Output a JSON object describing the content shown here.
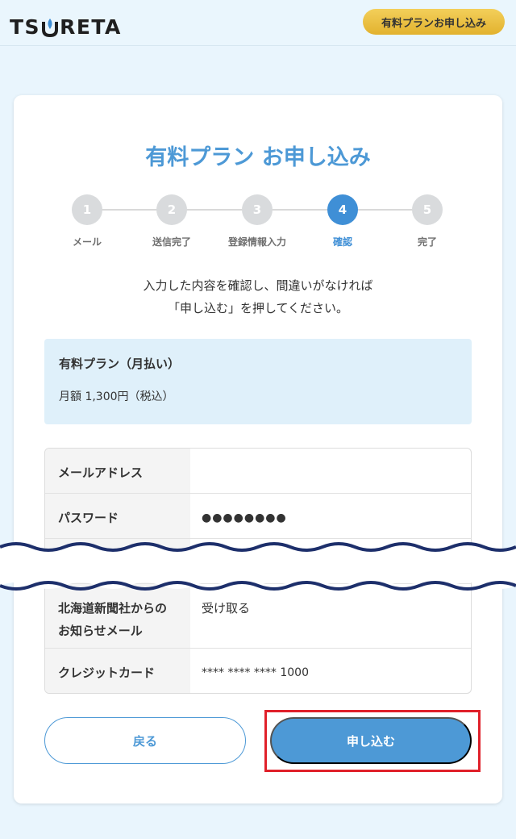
{
  "header": {
    "logo_text_left": "TS",
    "logo_text_right": "RETA",
    "cta_label": "有料プランお申し込み"
  },
  "page": {
    "title": "有料プラン お申し込み",
    "description_line1": "入力した内容を確認し、間違いがなければ",
    "description_line2": "「申し込む」を押してください。"
  },
  "stepper": {
    "steps": [
      {
        "number": "1",
        "label": "メール"
      },
      {
        "number": "2",
        "label": "送信完了"
      },
      {
        "number": "3",
        "label": "登録情報入力"
      },
      {
        "number": "4",
        "label": "確認"
      },
      {
        "number": "5",
        "label": "完了"
      }
    ],
    "active_step": 4
  },
  "plan": {
    "name": "有料プラン（月払い）",
    "price": "月額 1,300円（税込）"
  },
  "details": {
    "rows": [
      {
        "key": "メールアドレス",
        "value": ""
      },
      {
        "key": "パスワード",
        "value": "●●●●●●●●"
      },
      {
        "key": "北海道新聞社からのお知らせメール",
        "key_line1": "北海道新聞社からの",
        "key_line2": "お知らせメール",
        "value": "受け取る"
      },
      {
        "key": "クレジットカード",
        "value": "**** **** **** 1000"
      }
    ]
  },
  "buttons": {
    "back_label": "戻る",
    "submit_label": "申し込む"
  },
  "colors": {
    "accent": "#4d99d6",
    "highlight": "#e0202a",
    "header_cta": "#e9bd3e",
    "plan_bg": "#dff0fa"
  }
}
